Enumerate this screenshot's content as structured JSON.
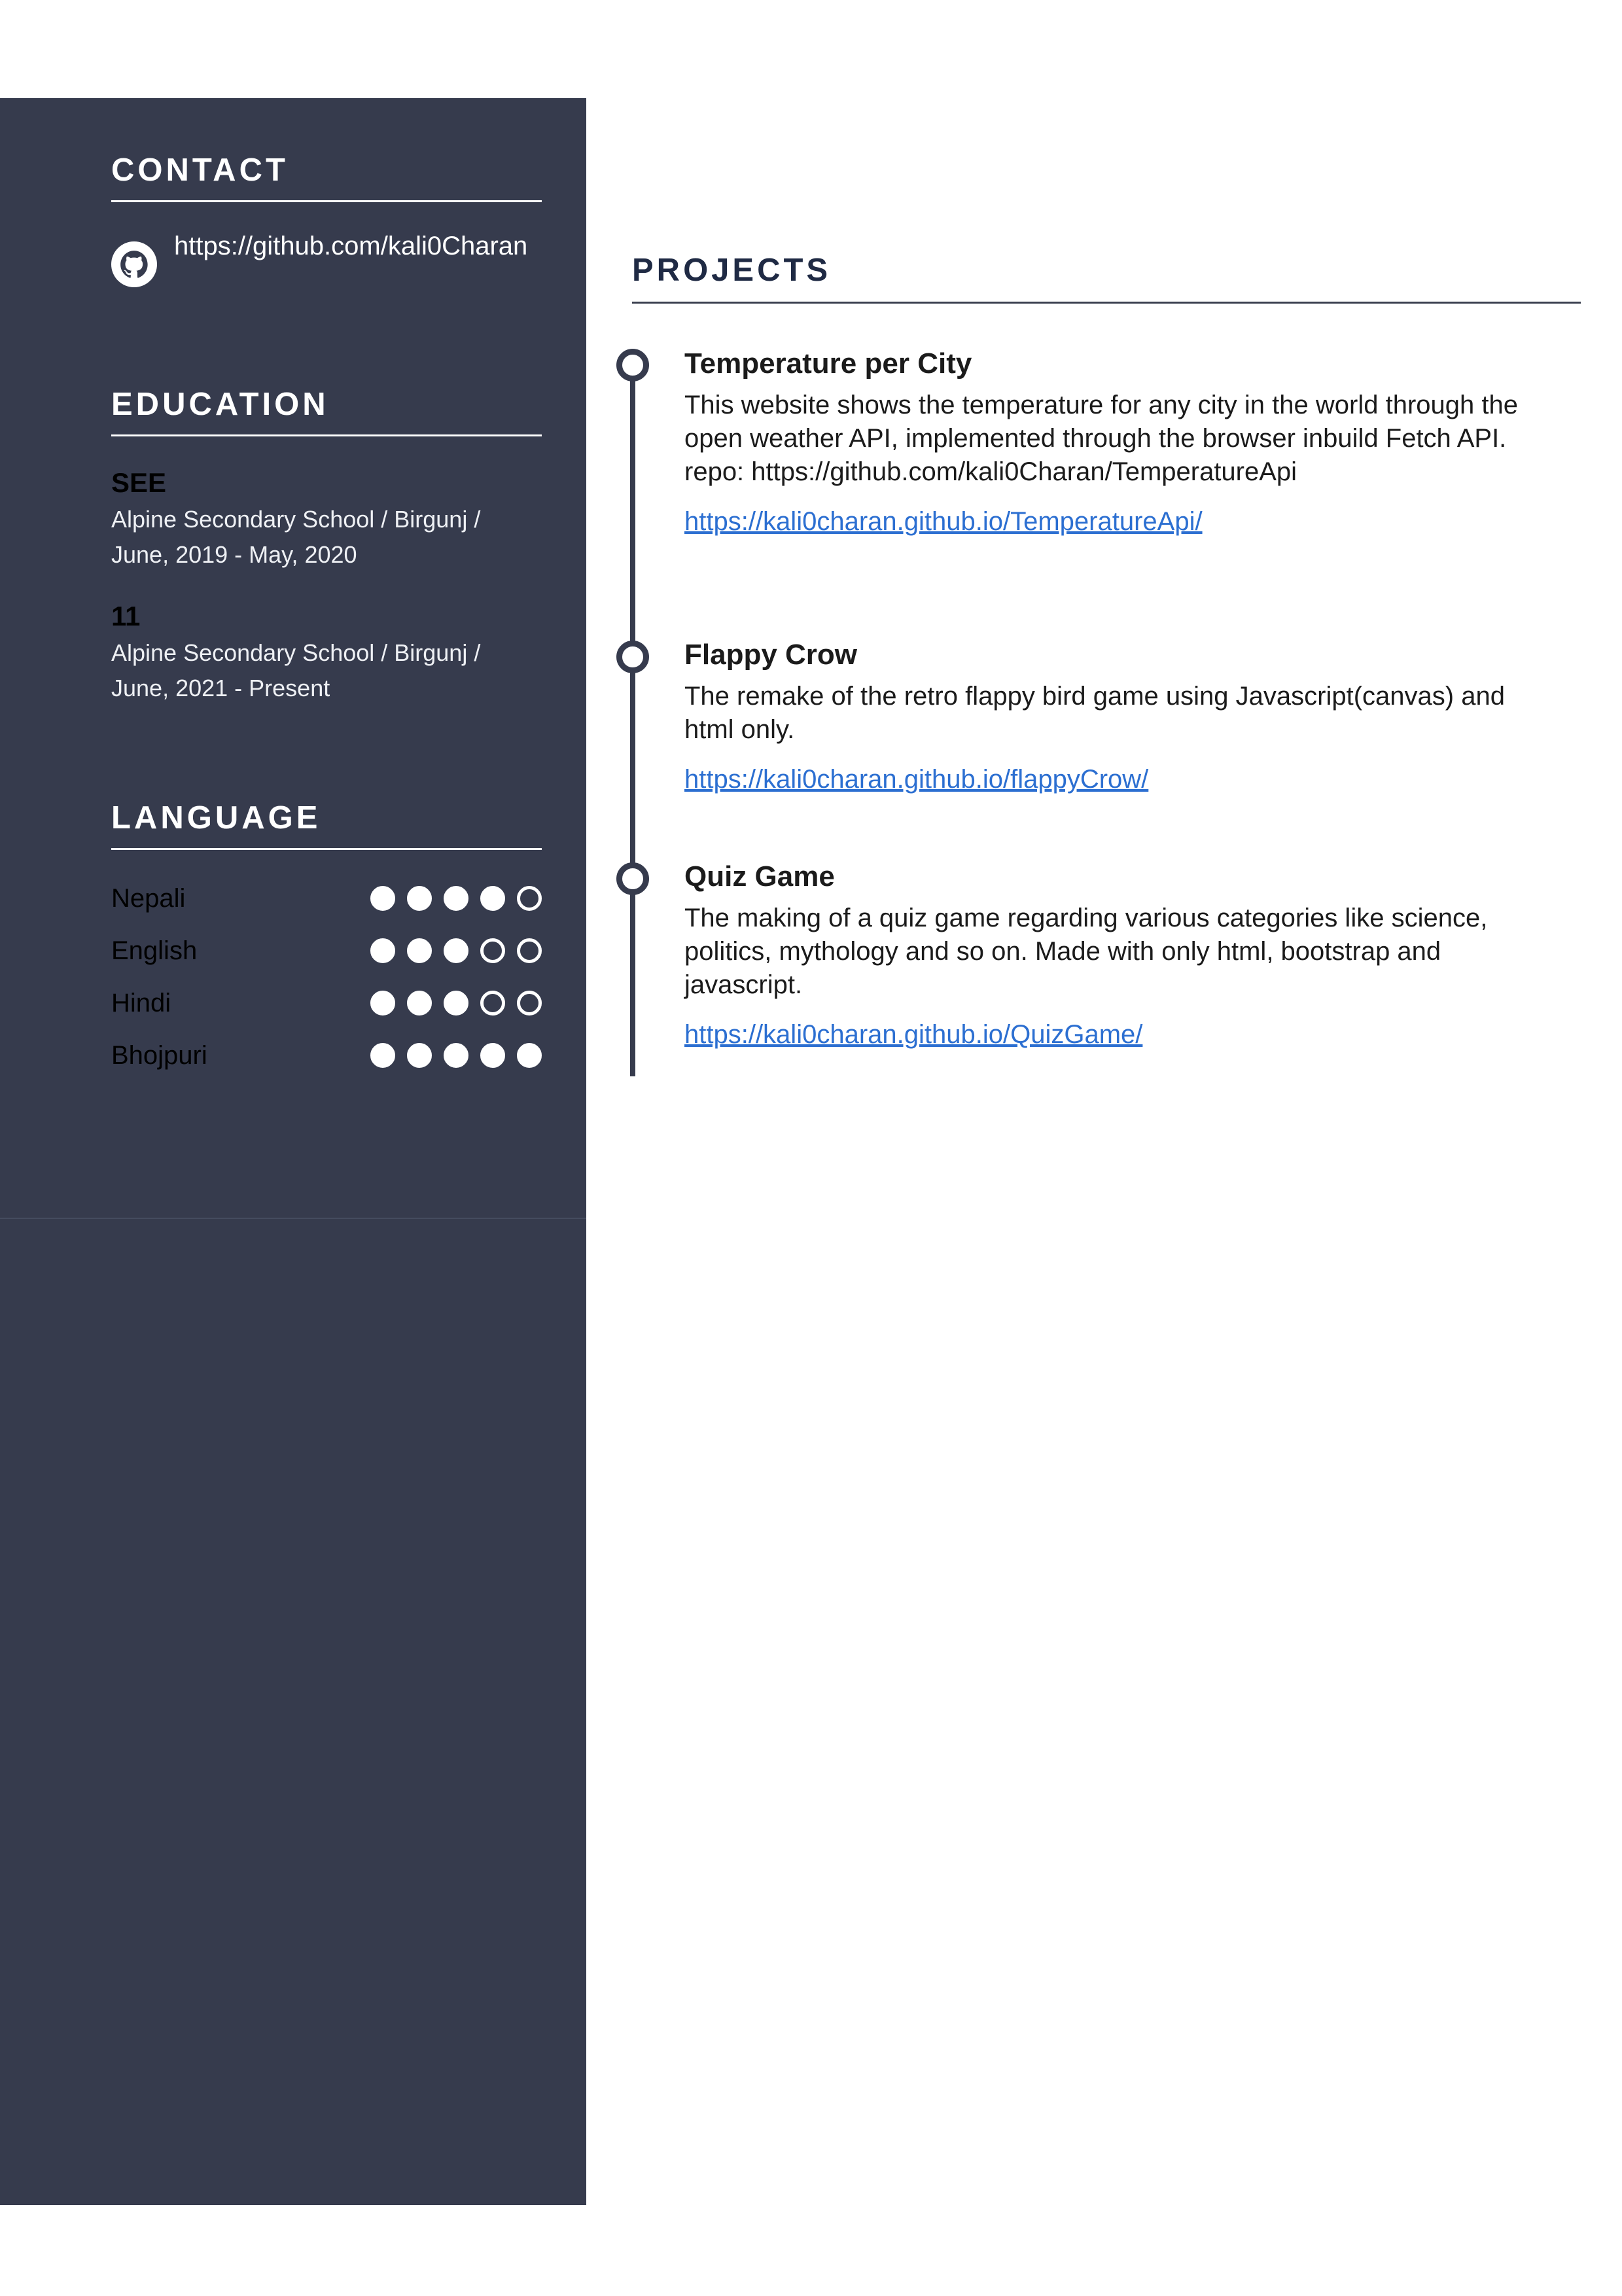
{
  "contact": {
    "heading": "CONTACT",
    "github": "https://github.com/kali0Charan",
    "icon": "github-icon"
  },
  "education": {
    "heading": "EDUCATION",
    "items": [
      {
        "title": "SEE",
        "detail": "Alpine Secondary School / Birgunj / June, 2019 - May, 2020"
      },
      {
        "title": "11",
        "detail": "Alpine Secondary School / Birgunj / June, 2021 - Present"
      }
    ]
  },
  "language": {
    "heading": "LANGUAGE",
    "items": [
      {
        "name": "Nepali",
        "level": 4,
        "max": 5
      },
      {
        "name": "English",
        "level": 3,
        "max": 5
      },
      {
        "name": "Hindi",
        "level": 3,
        "max": 5
      },
      {
        "name": "Bhojpuri",
        "level": 5,
        "max": 5
      }
    ]
  },
  "projects": {
    "heading": "PROJECTS",
    "items": [
      {
        "title": "Temperature per City",
        "description": "This website shows the temperature for any city in the world through the open weather API, implemented through the browser inbuild Fetch API.",
        "repo": "repo: https://github.com/kali0Charan/TemperatureApi",
        "link": "https://kali0charan.github.io/TemperatureApi/"
      },
      {
        "title": "Flappy Crow",
        "description": "The remake of the retro flappy bird game using Javascript(canvas) and html only.",
        "link": "https://kali0charan.github.io/flappyCrow/"
      },
      {
        "title": "Quiz Game",
        "description": "The making of a quiz game regarding various categories like science, politics, mythology and so on. Made with only html, bootstrap and javascript.",
        "link": "https://kali0charan.github.io/QuizGame/"
      }
    ]
  },
  "colors": {
    "sidebar": "#363b4d",
    "link": "#2c6fd1",
    "heading": "#1f2a44"
  }
}
